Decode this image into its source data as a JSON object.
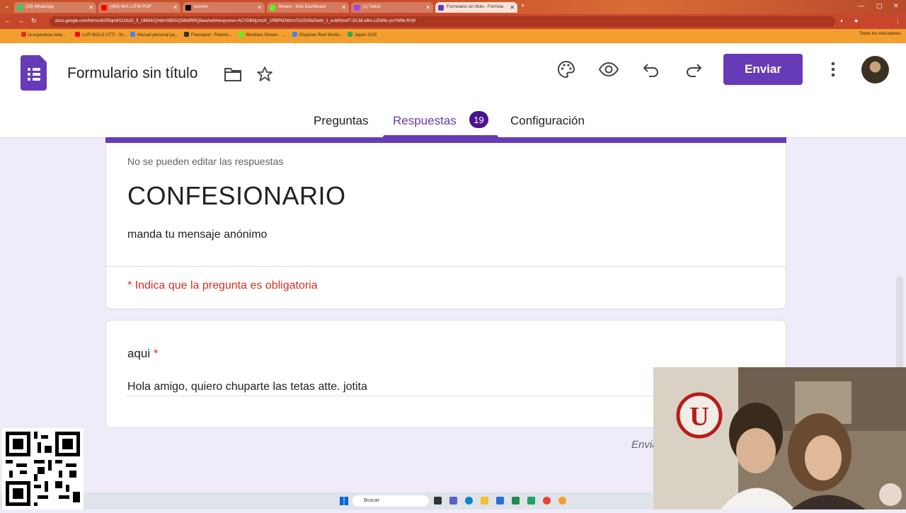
{
  "browser": {
    "tabs": [
      {
        "label": "(19) WhatsApp",
        "color": "#25d366"
      },
      {
        "label": "(463) MIX LATIN POP",
        "color": "#ff0000"
      },
      {
        "label": "kommo",
        "color": "#000000"
      },
      {
        "label": "Stream - Kick Dashboard",
        "color": "#53fc18"
      },
      {
        "label": "(1) Twitch",
        "color": "#9146ff"
      },
      {
        "label": "Formulario sin título - Formula",
        "color": "#673ab7"
      }
    ],
    "url": "docs.google.com/forms/d/1Rlqm6S2Ok32_fl_19854/Qm8mSB0GQ56k9RRQ8aw/edit#response=ACYDBNjzmcK_1RBP6OWzmTcOSS5eDwbt_1_euMSmxfT-3XJdi.wlhu-LEW6c-yvYWhb-RVj0",
    "bookmarks": [
      {
        "label": "la espantosa reda...",
        "color": "#d93025"
      },
      {
        "label": "LUFI BOLO UTTI - Yo...",
        "color": "#ff0000"
      },
      {
        "label": "Manual personal pa...",
        "color": "#4285f4"
      },
      {
        "label": "Freestand - Freests...",
        "color": "#333333"
      },
      {
        "label": "Windows Stream - ...",
        "color": "#53fc18"
      },
      {
        "label": "Disponer Reel Works...",
        "color": "#4285f4"
      },
      {
        "label": "Japon 2025",
        "color": "#34a853"
      }
    ],
    "all_bookmarks": "Todos los marcadores"
  },
  "header": {
    "title": "Formulario sin título",
    "send_label": "Enviar",
    "tabs": [
      {
        "label": "Preguntas"
      },
      {
        "label": "Respuestas",
        "count": "19",
        "selected": true
      },
      {
        "label": "Configuración"
      }
    ]
  },
  "form": {
    "notice": "No se pueden editar las respuestas",
    "title": "CONFESIONARIO",
    "description": "manda tu mensaje anónimo",
    "required_note": "* Indica que la pregunta es obligatoria",
    "question": {
      "label": "aqui",
      "required_mark": "*",
      "answer": "Hola amigo, quiero chuparte las tetas atte. jotita"
    },
    "footer_partial": "Envia"
  },
  "taskbar": {
    "search_placeholder": "Buscar"
  },
  "colors": {
    "accent": "#673ab7",
    "badge": "#4a148c",
    "required": "#d93025",
    "page_bg": "#f0ebf8"
  }
}
